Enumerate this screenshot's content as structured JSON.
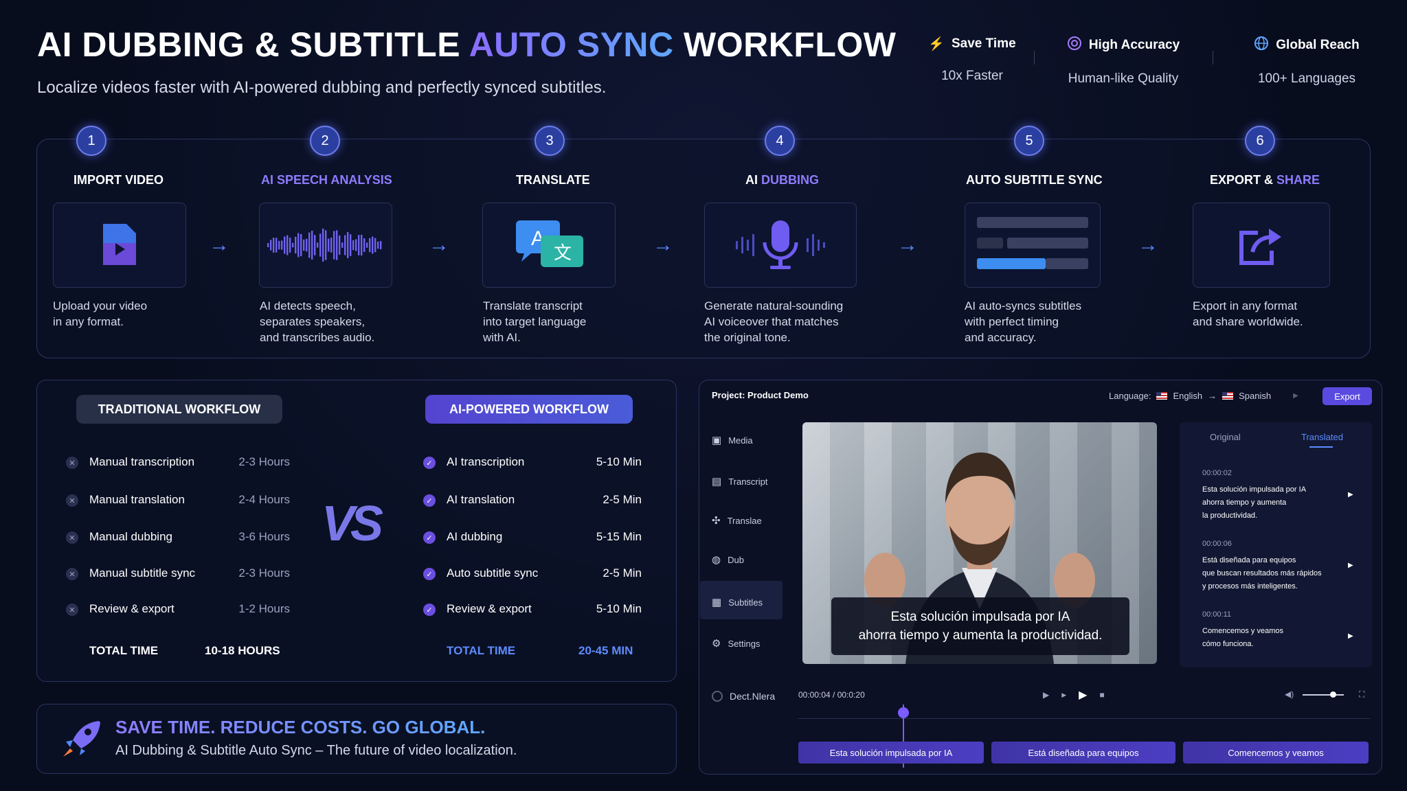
{
  "header": {
    "title_a": "AI DUBBING & SUBTITLE ",
    "title_b": "AUTO SYNC",
    "title_c": " WORKFLOW",
    "subtitle": "Localize videos faster with AI-powered dubbing and perfectly synced subtitles."
  },
  "features": [
    {
      "title": "Save Time",
      "sub": "10x Faster",
      "icon": "lightning-icon"
    },
    {
      "title": "High Accuracy",
      "sub": "Human-like Quality",
      "icon": "target-icon"
    },
    {
      "title": "Global Reach",
      "sub": "100+ Languages",
      "icon": "globe-icon"
    }
  ],
  "steps": [
    {
      "num": "1",
      "title_a": "IMPORT VIDEO",
      "title_b": "",
      "desc": "Upload your video\nin any format."
    },
    {
      "num": "2",
      "title_a": "",
      "title_b": "AI SPEECH ANALYSIS",
      "desc": "AI detects speech,\nseparates speakers,\nand transcribes audio."
    },
    {
      "num": "3",
      "title_a": "TRANSLATE",
      "title_b": "",
      "desc": "Translate transcript\ninto target language\nwith AI."
    },
    {
      "num": "4",
      "title_a": "AI ",
      "title_b": "DUBBING",
      "desc": "Generate natural-sounding\nAI voiceover that matches\nthe original tone."
    },
    {
      "num": "5",
      "title_a": "AUTO SUBTITLE SYNC",
      "title_b": "",
      "desc": "AI auto-syncs subtitles\nwith perfect timing\nand accuracy."
    },
    {
      "num": "6",
      "title_a": "EXPORT & ",
      "title_b": "SHARE",
      "desc": "Export in any format\nand share worldwide."
    }
  ],
  "traditional": {
    "label": "TRADITIONAL WORKFLOW",
    "rows": [
      [
        "Manual transcription",
        "2-3 Hours"
      ],
      [
        "Manual translation",
        "2-4 Hours"
      ],
      [
        "Manual dubbing",
        "3-6 Hours"
      ],
      [
        "Manual subtitle sync",
        "2-3 Hours"
      ],
      [
        "Review & export",
        "1-2 Hours"
      ]
    ],
    "total_label": "TOTAL TIME",
    "total": "10-18 HOURS"
  },
  "ai": {
    "label": "AI-POWERED WORKFLOW",
    "rows": [
      [
        "AI transcription",
        "5-10 Min"
      ],
      [
        "AI translation",
        "2-5 Min"
      ],
      [
        "AI dubbing",
        "5-15 Min"
      ],
      [
        "Auto subtitle sync",
        "2-5 Min"
      ],
      [
        "Review & export",
        "5-10 Min"
      ]
    ],
    "total_label": "TOTAL TIME",
    "total": "20-45 MIN"
  },
  "vs": "VS",
  "cta": {
    "headline": "SAVE TIME. REDUCE COSTS. GO GLOBAL.",
    "sub": "AI Dubbing & Subtitle Auto Sync – The future of video localization."
  },
  "app": {
    "project": "Project: Product Demo",
    "language_label": "Language:",
    "from": "English",
    "to": "Spanish",
    "export": "Export",
    "sidebar": [
      "Media",
      "Transcript",
      "Translae",
      "Dub",
      "Subtitles",
      "Settings"
    ],
    "brand": "Dect.Nlera",
    "caption_1": "Esta solución impulsada por IA",
    "caption_2": "ahorra tiempo y aumenta la productividad.",
    "tab_original": "Original",
    "tab_translated": "Translated",
    "segments": [
      {
        "time": "00:00:02",
        "text": "Esta solución impulsada por IA\nahorra tiempo y aumenta\nla productividad."
      },
      {
        "time": "00:00:06",
        "text": "Está diseñada para equipos\nque buscan resultados más rápidos\ny procesos más inteligentes."
      },
      {
        "time": "00:00:11",
        "text": "Comencemos y veamos\ncómo funciona."
      }
    ],
    "timecode": "00:00:04 / 00:0:20",
    "clips": [
      "Esta solución impulsada por IA",
      "Está diseñada para equipos",
      "Comencemos y veamos"
    ]
  },
  "colors": {
    "accent": "#7b5cff",
    "blue": "#4d8bff",
    "bg": "#080d1e"
  }
}
